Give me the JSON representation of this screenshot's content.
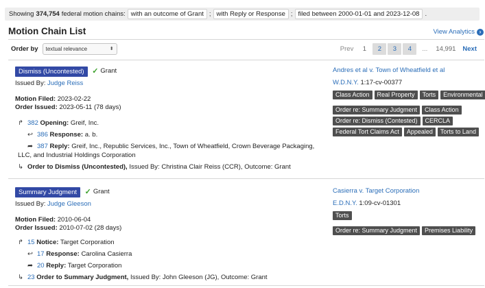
{
  "filter": {
    "prefix": "Showing",
    "count": "374,754",
    "suffix": "federal motion chains:",
    "chips": [
      "with an outcome of Grant",
      "with Reply or Response",
      "filed between 2000-01-01 and 2023-12-08"
    ],
    "separator": ";",
    "end": "."
  },
  "header": {
    "title": "Motion Chain List",
    "analytics_label": "View Analytics",
    "analytics_icon": "arrow-circle-icon"
  },
  "order": {
    "label": "Order by",
    "value": "textual relevance"
  },
  "pager": {
    "prev": "Prev",
    "pages": [
      "1",
      "2",
      "3",
      "4"
    ],
    "ellipsis": "...",
    "last": "14,991",
    "next": "Next"
  },
  "results": [
    {
      "type": "Dismiss (Uncontested)",
      "outcome": "Grant",
      "issued_by_label": "Issued By:",
      "judge": "Judge Reiss",
      "motion_filed_label": "Motion Filed:",
      "motion_filed": "2023-02-22",
      "order_issued_label": "Order Issued:",
      "order_issued": "2023-05-11 (78 days)",
      "opening": {
        "num": "382",
        "label": "Opening:",
        "text": "Greif, Inc."
      },
      "response": {
        "num": "386",
        "label": "Response:",
        "text": "a. b."
      },
      "reply": {
        "num": "387",
        "label": "Reply:",
        "text1": "Greif, Inc., Republic Services, Inc., Town of Wheatfield, Crown Beverage Packaging,",
        "text2": "LLC, and Industrial Holdings Corporation"
      },
      "order": {
        "num": "",
        "label": "Order to Dismiss (Uncontested),",
        "text": "Issued By: Christina Clair Reiss (CCR), Outcome: Grant"
      },
      "case_title": "Andres et al v. Town of Wheatfield et al",
      "court": "W.D.N.Y.",
      "docket": "1:17-cv-00377",
      "case_tags": [
        "Class Action",
        "Real Property",
        "Torts",
        "Environmental"
      ],
      "motion_tags": [
        "Order re: Summary Judgment",
        "Class Action",
        "Order re: Dismiss (Contested)",
        "CERCLA",
        "Federal Tort Claims Act",
        "Appealed",
        "Torts to Land"
      ]
    },
    {
      "type": "Summary Judgment",
      "outcome": "Grant",
      "issued_by_label": "Issued By:",
      "judge": "Judge Gleeson",
      "motion_filed_label": "Motion Filed:",
      "motion_filed": "2010-06-04",
      "order_issued_label": "Order Issued:",
      "order_issued": "2010-07-02 (28 days)",
      "opening": {
        "num": "15",
        "label": "Notice:",
        "text": "Target Corporation"
      },
      "response": {
        "num": "17",
        "label": "Response:",
        "text": "Carolina Casierra"
      },
      "reply": {
        "num": "20",
        "label": "Reply:",
        "text1": "Target Corporation",
        "text2": ""
      },
      "order": {
        "num": "23",
        "label": "Order to Summary Judgment,",
        "text": "Issued By: John Gleeson (JG), Outcome: Grant"
      },
      "case_title": "Casierra v. Target Corporation",
      "court": "E.D.N.Y.",
      "docket": "1:09-cv-01301",
      "case_tags": [
        "Torts"
      ],
      "motion_tags": [
        "Order re: Summary Judgment",
        "Premises Liability"
      ]
    }
  ]
}
